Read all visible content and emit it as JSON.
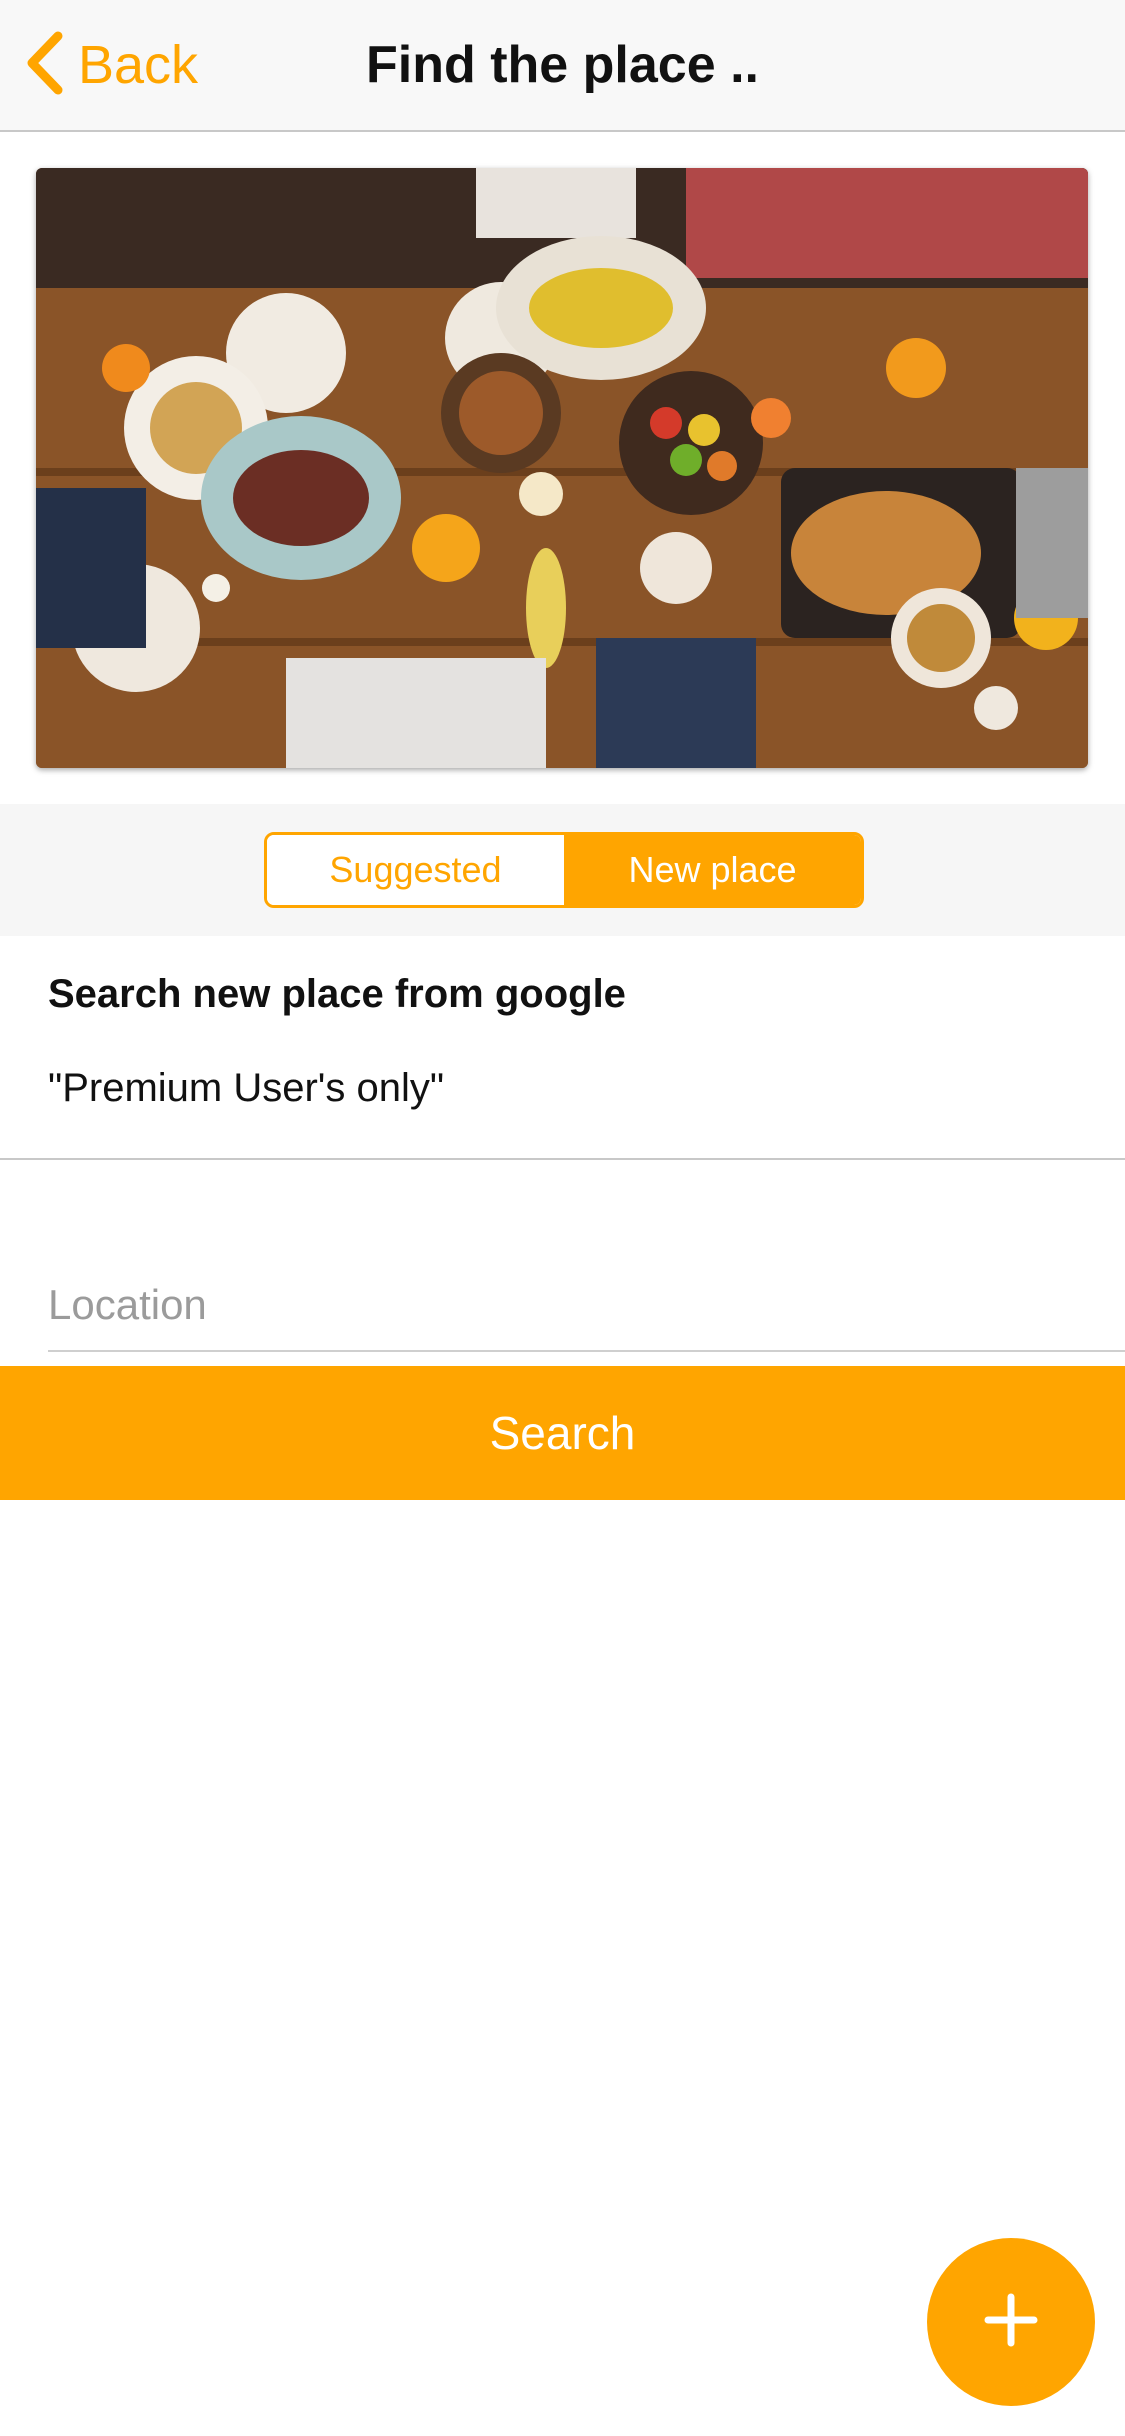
{
  "nav": {
    "back_label": "Back",
    "title": "Find the place .."
  },
  "hero": {
    "image_alt": "Overhead view of a festive dinner table with roasted turkey, corn, meat, vegetables and people serving food"
  },
  "segments": [
    {
      "label": "Suggested",
      "selected": false
    },
    {
      "label": "New place",
      "selected": true
    }
  ],
  "content": {
    "heading": "Search new place from google",
    "premium_note": "\"Premium User's only\""
  },
  "search": {
    "location_placeholder": "Location",
    "location_value": "",
    "button_label": "Search"
  },
  "icons": {
    "back": "chevron-left-icon",
    "fab": "plus-icon"
  },
  "colors": {
    "accent": "#ffa500",
    "nav_background": "#f8f8f8",
    "segment_area_background": "#f6f6f6",
    "placeholder": "#9b9b9b"
  }
}
